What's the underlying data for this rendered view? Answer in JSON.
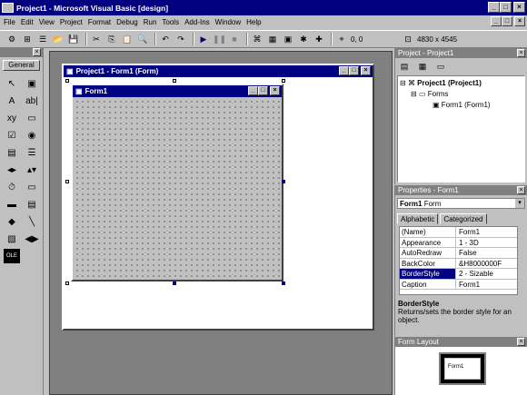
{
  "title": "Project1 - Microsoft Visual Basic [design]",
  "window_buttons": [
    "_",
    "□",
    "×"
  ],
  "menu": [
    "File",
    "Edit",
    "View",
    "Project",
    "Format",
    "Debug",
    "Run",
    "Tools",
    "Add-Ins",
    "Window",
    "Help"
  ],
  "toolbar": {
    "icons": [
      "add-project-icon",
      "add-form-icon",
      "menu-editor-icon",
      "open-icon",
      "save-icon",
      "cut-icon",
      "copy-icon",
      "paste-icon",
      "find-icon",
      "undo-icon",
      "redo-icon",
      "start-icon",
      "break-icon",
      "end-icon",
      "project-explorer-icon",
      "properties-icon",
      "form-layout-icon",
      "object-browser-icon",
      "toolbox-icon"
    ],
    "position": "0, 0",
    "size": "4830 x 4545"
  },
  "toolbox": {
    "tab_label": "General",
    "tools": [
      "pointer",
      "picture-box",
      "label",
      "text-box",
      "frame",
      "command-button",
      "check-box",
      "option-button",
      "combo-box",
      "list-box",
      "hscroll",
      "vscroll",
      "timer",
      "drive-list",
      "dir-list",
      "file-list",
      "shape",
      "line",
      "image",
      "data",
      "ole"
    ]
  },
  "glyphs": {
    "pointer": "↖",
    "picture-box": "▣",
    "label": "A",
    "text-box": "ab|",
    "frame": "xy",
    "command-button": "▭",
    "check-box": "☑",
    "option-button": "◉",
    "combo-box": "▤",
    "list-box": "☰",
    "hscroll": "◂▸",
    "vscroll": "▴▾",
    "timer": "⏱",
    "drive-list": "▭",
    "dir-list": "▬",
    "file-list": "▤",
    "shape": "◆",
    "line": "╲",
    "image": "▧",
    "data": "◀▶",
    "ole": "OLE"
  },
  "project_window": {
    "title": "Project1 - Form1 (Form)"
  },
  "form": {
    "title": "Form1"
  },
  "project_explorer": {
    "title": "Project - Project1",
    "nodes": [
      "Project1 (Project1)",
      "Forms",
      "Form1 (Form1)"
    ]
  },
  "properties": {
    "title": "Properties - Form1",
    "object": "Form1",
    "object_type": "Form",
    "tabs": [
      "Alphabetic",
      "Categorized"
    ],
    "rows": [
      {
        "name": "(Name)",
        "value": "Form1"
      },
      {
        "name": "Appearance",
        "value": "1 - 3D"
      },
      {
        "name": "AutoRedraw",
        "value": "False"
      },
      {
        "name": "BackColor",
        "value": "&H8000000F"
      },
      {
        "name": "BorderStyle",
        "value": "2 - Sizable"
      },
      {
        "name": "Caption",
        "value": "Form1"
      }
    ],
    "selected": "BorderStyle",
    "desc_title": "BorderStyle",
    "desc_text": "Returns/sets the border style for an object."
  },
  "form_layout": {
    "title": "Form Layout",
    "preview_label": "Form1"
  }
}
